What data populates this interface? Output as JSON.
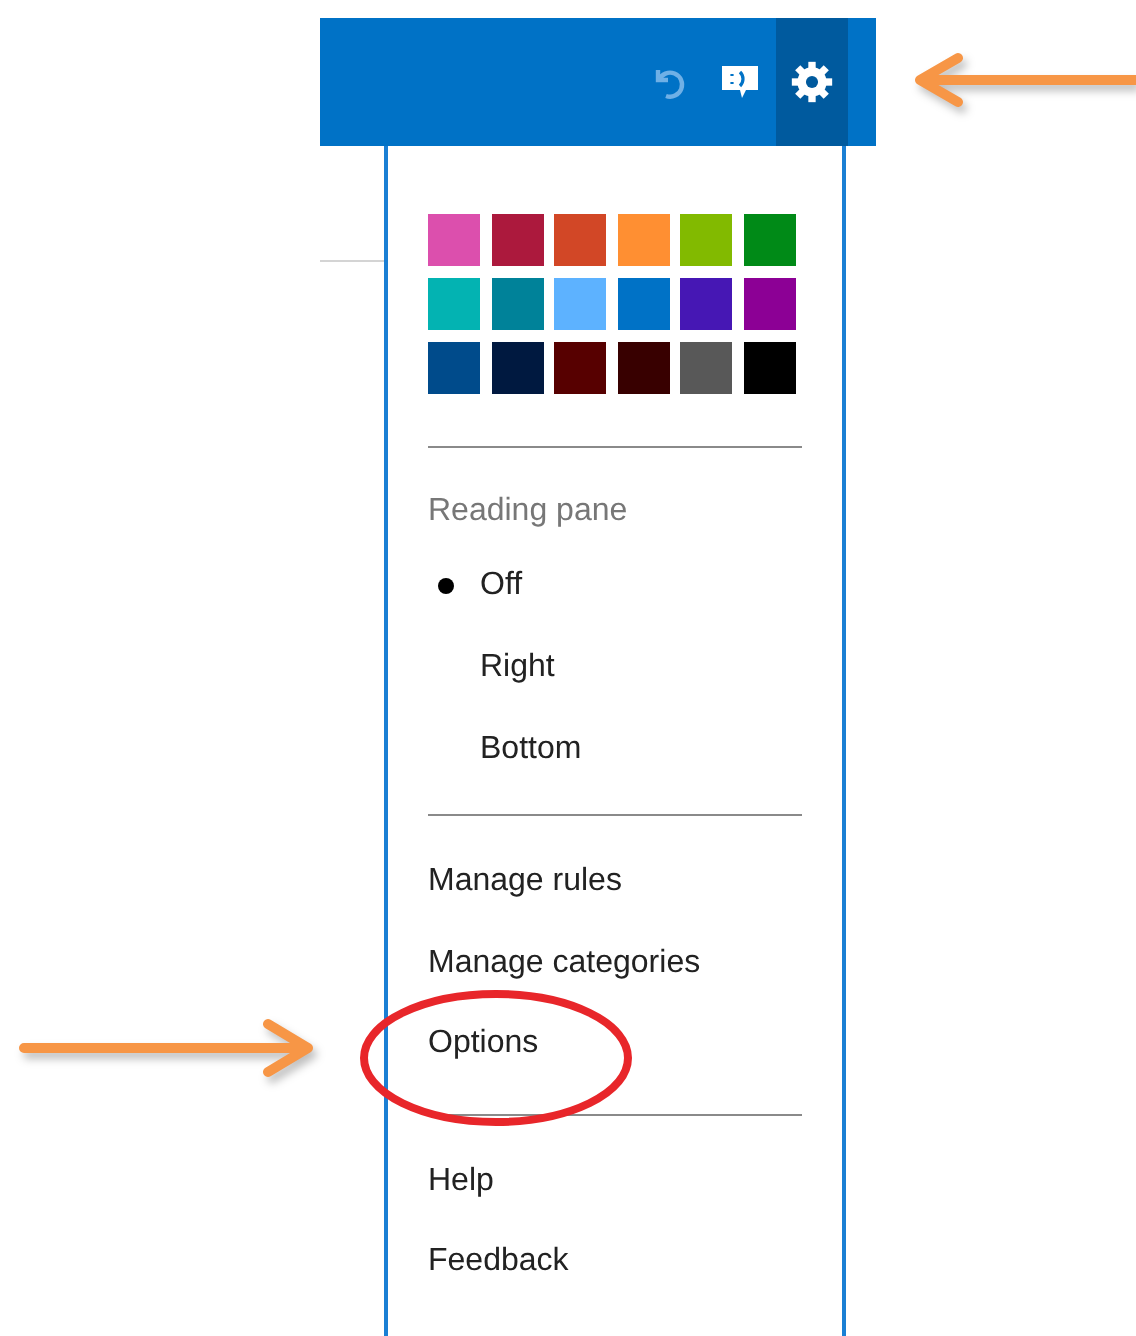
{
  "header": {
    "buttons": [
      {
        "kind": "undo",
        "disabled": true,
        "selected": false
      },
      {
        "kind": "feedback",
        "disabled": false,
        "selected": false
      },
      {
        "kind": "settings",
        "disabled": false,
        "selected": true
      }
    ]
  },
  "settings_menu": {
    "theme_colors": [
      {
        "color": "#dc4fad"
      },
      {
        "color": "#ac193d"
      },
      {
        "color": "#d24726"
      },
      {
        "color": "#ff8f32"
      },
      {
        "color": "#82ba00"
      },
      {
        "color": "#008a17"
      },
      {
        "color": "#03b3b2"
      },
      {
        "color": "#008299"
      },
      {
        "color": "#5db2ff"
      },
      {
        "color": "#0072c6"
      },
      {
        "color": "#4617b4"
      },
      {
        "color": "#8c0095"
      },
      {
        "color": "#004b8b"
      },
      {
        "color": "#001940"
      },
      {
        "color": "#570000"
      },
      {
        "color": "#380000"
      },
      {
        "color": "#585858"
      },
      {
        "color": "#000000"
      }
    ],
    "reading_pane": {
      "heading": "Reading pane",
      "options": [
        {
          "label": "Off",
          "selected": true
        },
        {
          "label": "Right",
          "selected": false
        },
        {
          "label": "Bottom",
          "selected": false
        }
      ]
    },
    "groups": [
      [
        "Manage rules",
        "Manage categories",
        "Options"
      ],
      [
        "Help",
        "Feedback"
      ]
    ]
  }
}
